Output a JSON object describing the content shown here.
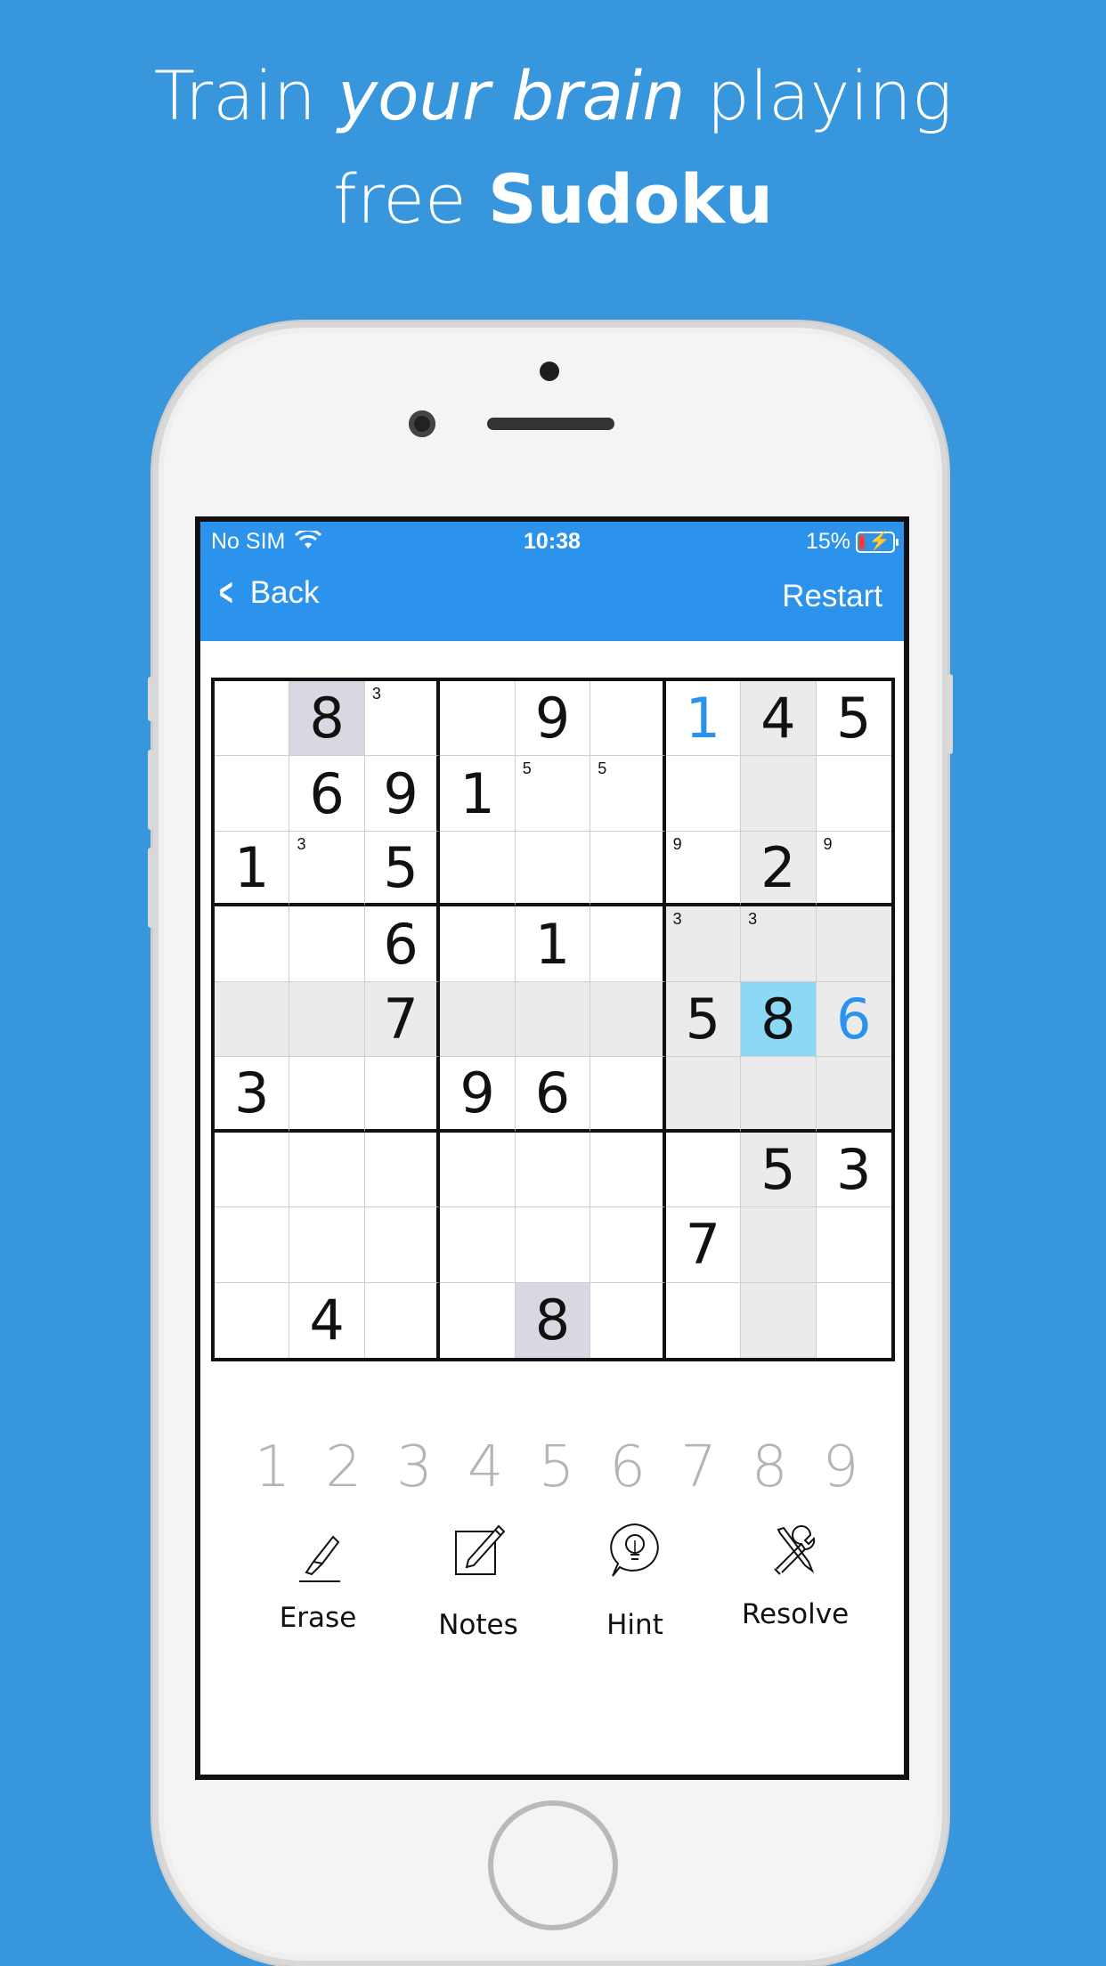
{
  "headline": {
    "line1_pre": "Train ",
    "line1_italic": "your brain",
    "line1_post": " playing",
    "line2_pre": "free ",
    "line2_bold": "Sudoku"
  },
  "status_bar": {
    "carrier": "No SIM",
    "time": "10:38",
    "battery": "15%"
  },
  "nav": {
    "back_label": "Back",
    "restart_label": "Restart"
  },
  "grid": {
    "values": [
      [
        "",
        "8",
        "",
        "",
        "9",
        "",
        "1",
        "4",
        "5"
      ],
      [
        "",
        "6",
        "9",
        "1",
        "",
        "",
        "",
        "",
        ""
      ],
      [
        "1",
        "",
        "5",
        "",
        "",
        "",
        "",
        "2",
        ""
      ],
      [
        "",
        "",
        "6",
        "",
        "1",
        "",
        "",
        "",
        ""
      ],
      [
        "",
        "",
        "7",
        "",
        "",
        "",
        "5",
        "8",
        "6"
      ],
      [
        "3",
        "",
        "",
        "9",
        "6",
        "",
        "",
        "",
        ""
      ],
      [
        "",
        "",
        "",
        "",
        "",
        "",
        "",
        "5",
        "3"
      ],
      [
        "",
        "",
        "",
        "",
        "",
        "",
        "7",
        "",
        ""
      ],
      [
        "",
        "4",
        "",
        "",
        "8",
        "",
        "",
        "",
        ""
      ]
    ],
    "notes": [
      [
        "",
        "",
        "3",
        "",
        "",
        "",
        "",
        "",
        ""
      ],
      [
        "",
        "",
        "",
        "",
        "5",
        "5",
        "",
        "",
        ""
      ],
      [
        "",
        "3",
        "",
        "",
        "",
        "",
        "9",
        "",
        "9"
      ],
      [
        "",
        "",
        "",
        "",
        "",
        "",
        "3",
        "3",
        ""
      ],
      [
        "",
        "",
        "",
        "",
        "",
        "",
        "",
        "",
        ""
      ],
      [
        "",
        "",
        "",
        "",
        "",
        "",
        "",
        "",
        ""
      ],
      [
        "",
        "",
        "",
        "",
        "",
        "",
        "",
        "",
        ""
      ],
      [
        "",
        "",
        "",
        "",
        "",
        "",
        "",
        "",
        ""
      ],
      [
        "",
        "",
        "",
        "",
        "",
        "",
        "",
        "",
        ""
      ]
    ],
    "user_entered": [
      [
        0,
        6
      ],
      [
        4,
        8
      ]
    ],
    "selected": [
      4,
      7
    ],
    "same_value_highlight": [
      [
        0,
        1
      ],
      [
        8,
        4
      ]
    ]
  },
  "numpad": [
    "1",
    "2",
    "3",
    "4",
    "5",
    "6",
    "7",
    "8",
    "9"
  ],
  "tools": [
    {
      "label": "Erase",
      "icon": "eraser-icon"
    },
    {
      "label": "Notes",
      "icon": "notes-pencil-icon"
    },
    {
      "label": "Hint",
      "icon": "lightbulb-icon"
    },
    {
      "label": "Resolve",
      "icon": "wrench-screwdriver-icon"
    }
  ],
  "colors": {
    "background": "#3896dc",
    "appbar": "#2b93ec",
    "selected_cell": "#8cd9f6",
    "user_digit": "#2b93ec"
  }
}
